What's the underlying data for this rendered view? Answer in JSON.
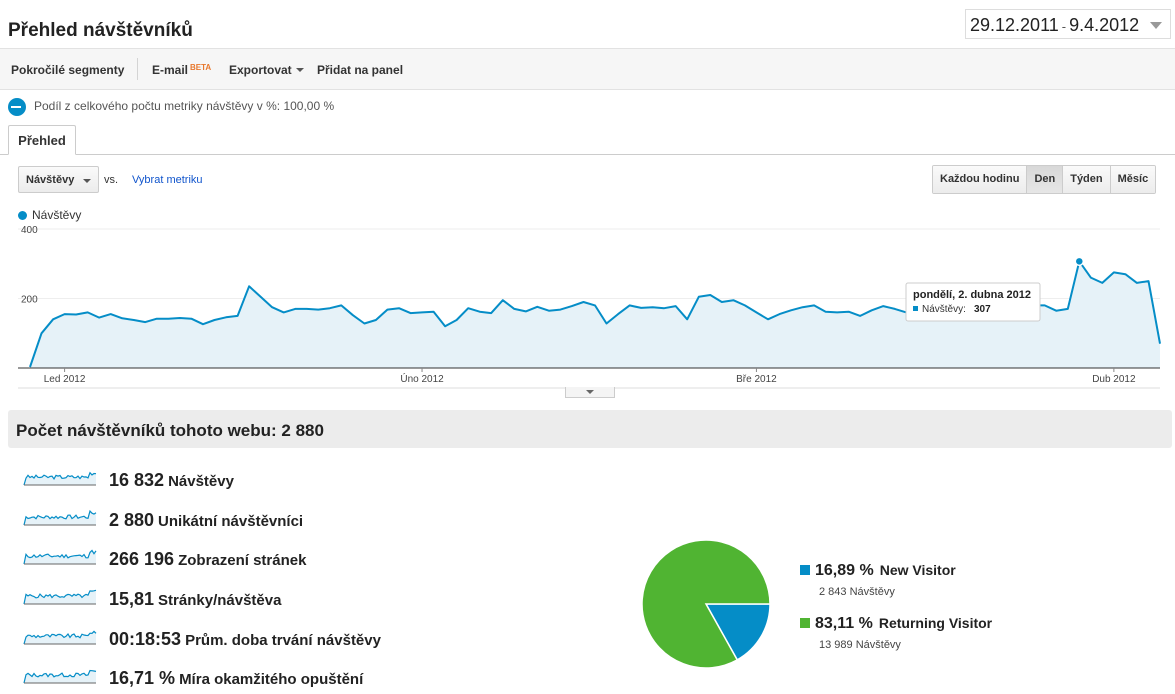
{
  "header": {
    "title": "Přehled návštěvníků",
    "date_start": "29.12.2011",
    "date_sep": "-",
    "date_end": "9.4.2012"
  },
  "toolbar": {
    "advanced_segments": "Pokročilé segmenty",
    "email": "E-mail",
    "email_badge": "BETA",
    "export": "Exportovat",
    "add_to_dashboard": "Přidat na panel"
  },
  "segment_text": "Podíl z celkového počtu metriky návštěvy v %: 100,00 %",
  "tab_overview": "Přehled",
  "metric_select": "Návštěvy",
  "vs_label": "vs.",
  "select_metric_link": "Vybrat metriku",
  "granularity": [
    "Každou hodinu",
    "Den",
    "Týden",
    "Měsíc"
  ],
  "granularity_active": "Den",
  "chart_data": {
    "type": "area",
    "legend": "Návštěvy",
    "ylim": [
      0,
      400
    ],
    "yticks": [
      "400",
      "200"
    ],
    "xticks": [
      "Led 2012",
      "Úno 2012",
      "Bře 2012",
      "Dub 2012"
    ],
    "x_start": "2011-12-29",
    "x_end": "2012-04-09",
    "color": "#058dc7",
    "values": [
      3,
      100,
      140,
      155,
      154,
      160,
      145,
      155,
      143,
      138,
      132,
      142,
      142,
      144,
      142,
      126,
      138,
      146,
      150,
      235,
      205,
      175,
      160,
      170,
      170,
      168,
      172,
      180,
      152,
      128,
      138,
      168,
      172,
      158,
      160,
      162,
      120,
      138,
      172,
      162,
      158,
      195,
      170,
      163,
      176,
      165,
      168,
      178,
      190,
      180,
      128,
      155,
      180,
      173,
      175,
      172,
      178,
      140,
      205,
      210,
      190,
      195,
      180,
      160,
      140,
      155,
      166,
      175,
      180,
      162,
      160,
      162,
      150,
      166,
      178,
      170,
      160,
      165,
      148,
      160,
      175,
      182,
      170,
      158,
      174,
      178,
      172,
      180,
      180,
      165,
      170,
      307,
      260,
      245,
      275,
      270,
      245,
      250,
      70
    ],
    "tooltip": {
      "date": "pondělí, 2. dubna 2012",
      "metric": "Návštěvy:",
      "value": "307"
    }
  },
  "summary": {
    "title": "Počet návštěvníků tohoto webu: 2 880",
    "kpis": [
      {
        "value": "16 832",
        "label": "Návštěvy"
      },
      {
        "value": "2 880",
        "label": "Unikátní návštěvníci"
      },
      {
        "value": "266 196",
        "label": "Zobrazení stránek"
      },
      {
        "value": "15,81",
        "label": "Stránky/návštěva"
      },
      {
        "value": "00:18:53",
        "label": "Prům. doba trvání návštěvy"
      },
      {
        "value": "16,71 %",
        "label": "Míra okamžitého opuštění"
      }
    ]
  },
  "pie_chart": {
    "type": "pie",
    "slices": [
      {
        "name": "New Visitor",
        "pct_label": "16,89 %",
        "value": 16.89,
        "count_label": "2 843 Návštěvy",
        "color": "#058dc7"
      },
      {
        "name": "Returning Visitor",
        "pct_label": "83,11 %",
        "value": 83.11,
        "count_label": "13 989 Návštěvy",
        "color": "#50b432"
      }
    ]
  }
}
